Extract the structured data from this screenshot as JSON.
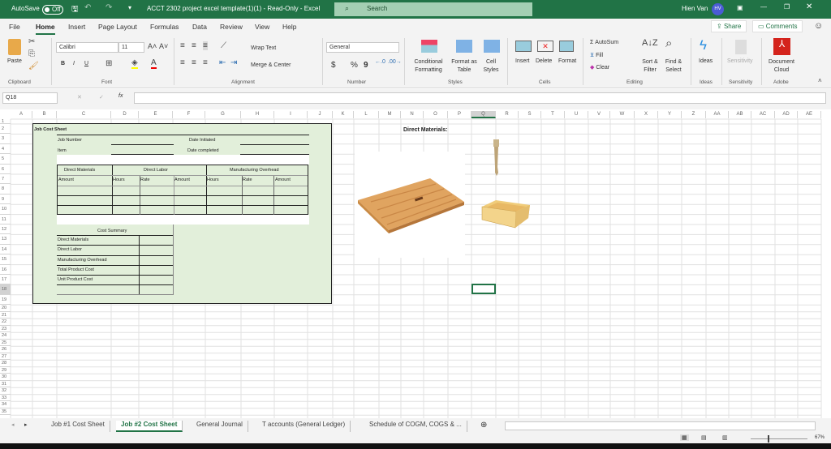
{
  "titlebar": {
    "autosave": "AutoSave",
    "autosave_state": "Off",
    "title": "ACCT 2302 project excel template(1)(1)  -  Read-Only  -  Excel",
    "search": "Search",
    "user": "Hien Van",
    "initials": "HV"
  },
  "menu": {
    "tabs": [
      "File",
      "Home",
      "Insert",
      "Page Layout",
      "Formulas",
      "Data",
      "Review",
      "View",
      "Help"
    ],
    "share": "Share",
    "comments": "Comments"
  },
  "ribbon": {
    "clipboard": {
      "paste": "Paste",
      "label": "Clipboard"
    },
    "font": {
      "name": "Calibri",
      "size": "11",
      "label": "Font",
      "bold": "B",
      "italic": "I",
      "underline": "U"
    },
    "alignment": {
      "wrap": "Wrap Text",
      "merge": "Merge & Center",
      "label": "Alignment"
    },
    "number": {
      "format": "General",
      "currency": "$",
      "percent": "%",
      "comma": "9",
      "label": "Number"
    },
    "styles": {
      "conditional": "Conditional Formatting",
      "format_table": "Format as Table",
      "cell_styles": "Cell Styles",
      "label": "Styles"
    },
    "cells": {
      "insert": "Insert",
      "delete": "Delete",
      "format": "Format",
      "label": "Cells"
    },
    "editing": {
      "autosum": "AutoSum",
      "fill": "Fill",
      "clear": "Clear",
      "sort": "Sort & Filter",
      "find": "Find & Select",
      "label": "Editing"
    },
    "ideas": {
      "ideas": "Ideas",
      "label": "Ideas"
    },
    "sensitivity": {
      "sensitivity": "Sensitivity",
      "label": "Sensitivity"
    },
    "adobe": {
      "doc_cloud": "Document Cloud",
      "label": "Adobe"
    }
  },
  "formula_bar": {
    "name_box": "Q18",
    "fx": "fx",
    "value": ""
  },
  "columns": [
    "A",
    "B",
    "C",
    "D",
    "E",
    "F",
    "G",
    "H",
    "I",
    "J",
    "K",
    "L",
    "M",
    "N",
    "O",
    "P",
    "Q",
    "R",
    "S",
    "T",
    "U",
    "V",
    "W",
    "X",
    "Y",
    "Z",
    "AA",
    "AB",
    "AC",
    "AD",
    "AE"
  ],
  "job_cost_sheet": {
    "title": "Job Cost Sheet",
    "job_number": "Job Number",
    "item": "Item",
    "date_initiated": "Date  Initiated",
    "date_completed": "Date completed",
    "groups": [
      "Direct Materials",
      "Direct Labor",
      "Manufacturing Overhead"
    ],
    "subheaders": [
      "Amount",
      "Hours",
      "Rate",
      "Amount",
      "Hours",
      "Rate",
      "Amount"
    ],
    "cost_summary": {
      "title": "Cost Summary",
      "rows": [
        "Direct Materials",
        "Direct Labor",
        "Manufacturing Overhead",
        "Total Product Cost",
        "Unit Product Cost"
      ]
    }
  },
  "materials_label": "Direct Materials:",
  "sheet_tabs": [
    "Job #1 Cost Sheet",
    "Job #2 Cost Sheet",
    "General Journal",
    "T accounts (General Ledger)",
    "Schedule of COGM, COGS & ..."
  ],
  "active_sheet": 1,
  "status": {
    "zoom": "67%"
  },
  "colors": {
    "excel_green": "#217346",
    "form_fill": "#e2efda"
  }
}
